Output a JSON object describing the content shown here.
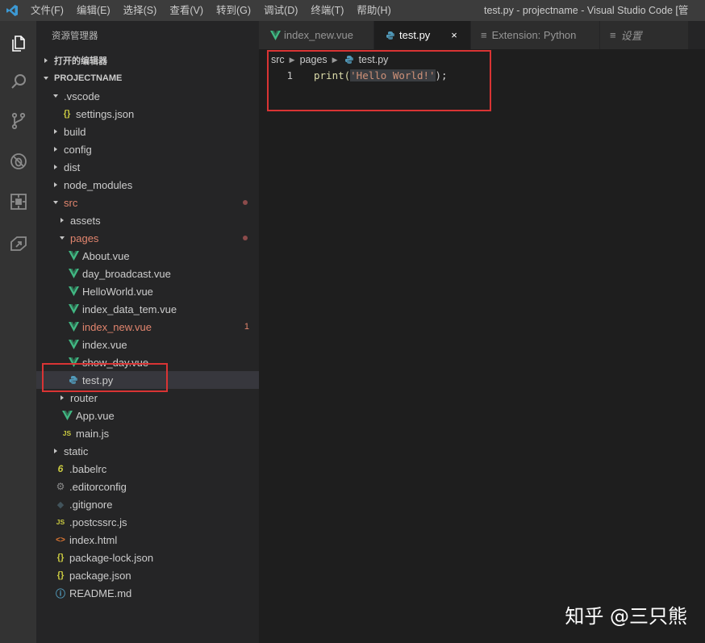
{
  "window": {
    "menu": [
      "文件(F)",
      "编辑(E)",
      "选择(S)",
      "查看(V)",
      "转到(G)",
      "调试(D)",
      "终端(T)",
      "帮助(H)"
    ],
    "title": "test.py - projectname - Visual Studio Code [管"
  },
  "activity_bar": [
    "explorer-icon",
    "search-icon",
    "source-control-icon",
    "debug-icon",
    "extensions-icon",
    "remote-icon"
  ],
  "sidebar": {
    "title": "资源管理器",
    "open_editors_label": "打开的编辑器",
    "project_label": "PROJECTNAME",
    "tree": [
      {
        "label": ".vscode",
        "kind": "folder-open",
        "depth": 1
      },
      {
        "label": "settings.json",
        "kind": "json",
        "depth": 2
      },
      {
        "label": "build",
        "kind": "folder",
        "depth": 1
      },
      {
        "label": "config",
        "kind": "folder",
        "depth": 1
      },
      {
        "label": "dist",
        "kind": "folder",
        "depth": 1
      },
      {
        "label": "node_modules",
        "kind": "folder",
        "depth": 1
      },
      {
        "label": "src",
        "kind": "folder-open",
        "depth": 1,
        "modified": true,
        "dot": true
      },
      {
        "label": "assets",
        "kind": "folder",
        "depth": 2
      },
      {
        "label": "pages",
        "kind": "folder-open",
        "depth": 2,
        "modified": true,
        "dot": true
      },
      {
        "label": "About.vue",
        "kind": "vue",
        "depth": 3
      },
      {
        "label": "day_broadcast.vue",
        "kind": "vue",
        "depth": 3
      },
      {
        "label": "HelloWorld.vue",
        "kind": "vue",
        "depth": 3
      },
      {
        "label": "index_data_tem.vue",
        "kind": "vue",
        "depth": 3
      },
      {
        "label": "index_new.vue",
        "kind": "vue",
        "depth": 3,
        "modified": true,
        "badge": "1"
      },
      {
        "label": "index.vue",
        "kind": "vue",
        "depth": 3
      },
      {
        "label": "show_day.vue",
        "kind": "vue",
        "depth": 3
      },
      {
        "label": "test.py",
        "kind": "python",
        "depth": 3,
        "active": true
      },
      {
        "label": "router",
        "kind": "folder",
        "depth": 2
      },
      {
        "label": "App.vue",
        "kind": "vue",
        "depth": 2
      },
      {
        "label": "main.js",
        "kind": "js",
        "depth": 2
      },
      {
        "label": "static",
        "kind": "folder",
        "depth": 1
      },
      {
        "label": ".babelrc",
        "kind": "babel",
        "depth": 1
      },
      {
        "label": ".editorconfig",
        "kind": "gear",
        "depth": 1
      },
      {
        "label": ".gitignore",
        "kind": "git",
        "depth": 1
      },
      {
        "label": ".postcssrc.js",
        "kind": "js",
        "depth": 1
      },
      {
        "label": "index.html",
        "kind": "html",
        "depth": 1
      },
      {
        "label": "package-lock.json",
        "kind": "json",
        "depth": 1
      },
      {
        "label": "package.json",
        "kind": "json",
        "depth": 1
      },
      {
        "label": "README.md",
        "kind": "info",
        "depth": 1
      }
    ]
  },
  "tabs": [
    {
      "label": "index_new.vue",
      "icon": "vue",
      "active": false
    },
    {
      "label": "test.py",
      "icon": "python",
      "active": true,
      "close": "×"
    },
    {
      "label": "Extension: Python",
      "icon": "preview",
      "active": false
    },
    {
      "label": "设置",
      "icon": "preview",
      "active": false
    }
  ],
  "breadcrumb": [
    "src",
    "pages",
    "test.py"
  ],
  "editor": {
    "line_number": "1",
    "code_fn": "print(",
    "code_str": "'Hello World!'",
    "code_end": ");"
  },
  "watermark": "知乎 @三只熊",
  "colors": {
    "vue_green": "#41b883",
    "python_blue": "#519aba",
    "json_yellow": "#cbcb41",
    "highlight_red": "#d93434"
  }
}
